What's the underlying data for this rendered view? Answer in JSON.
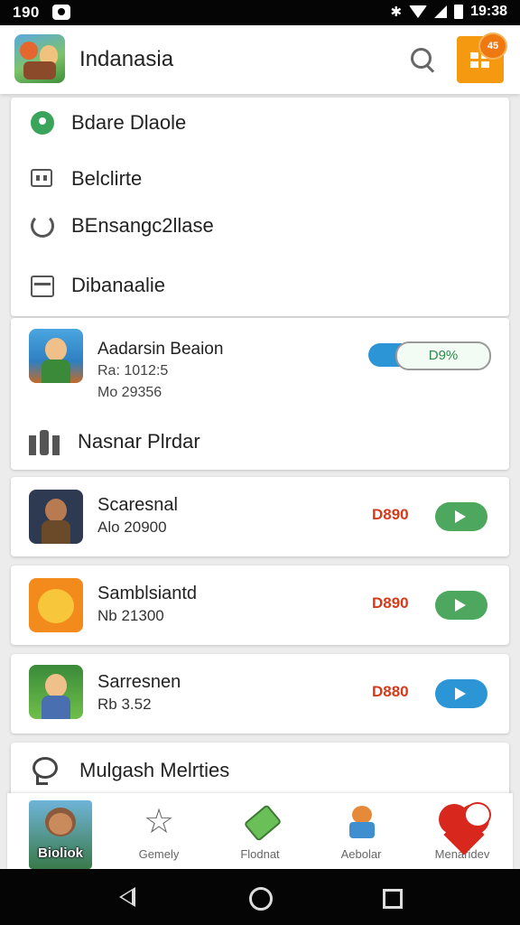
{
  "status_bar": {
    "time_left": "190",
    "time_right": "19:38"
  },
  "app_bar": {
    "title": "Indanasia",
    "badge": "45"
  },
  "menu": {
    "items": [
      {
        "label": "Bdare Dlaole",
        "icon": "location-pin-icon"
      },
      {
        "label": "Belclirte",
        "icon": "calculator-icon"
      },
      {
        "label": "BEnsangc2llase",
        "icon": "refresh-cycle-icon"
      },
      {
        "label": "Dibanaalie",
        "icon": "tray-icon"
      }
    ]
  },
  "download": {
    "title": "Aadarsin Beaion",
    "line1": "Ra: 1012:5",
    "line2": "Mo 29356",
    "progress_label": "D9%",
    "player_label": "Nasnar Plrdar"
  },
  "games": [
    {
      "title": "Scaresnal",
      "subtitle": "Alo 20900",
      "price": "D890",
      "button_color": "#4ea75f"
    },
    {
      "title": "Samblsiantd",
      "subtitle": "Nb 21300",
      "price": "D890",
      "button_color": "#4ea75f"
    },
    {
      "title": "Sarresnen",
      "subtitle": "Rb 3.52",
      "price": "D880",
      "button_color": "#2b95d6"
    }
  ],
  "community": {
    "label": "Mulgash Melrties"
  },
  "tabs": [
    {
      "label": "Bioliok",
      "icon": "avatar-thumb-icon"
    },
    {
      "label": "Gemely",
      "icon": "star-icon"
    },
    {
      "label": "Flodnat",
      "icon": "battery-icon"
    },
    {
      "label": "Aebolar",
      "icon": "character-icon"
    },
    {
      "label": "Menaridev",
      "icon": "heart-chat-icon"
    }
  ],
  "colors": {
    "accent_orange": "#f59a10",
    "price_red": "#d63a1a",
    "green": "#4ea75f",
    "blue": "#2b95d6"
  }
}
